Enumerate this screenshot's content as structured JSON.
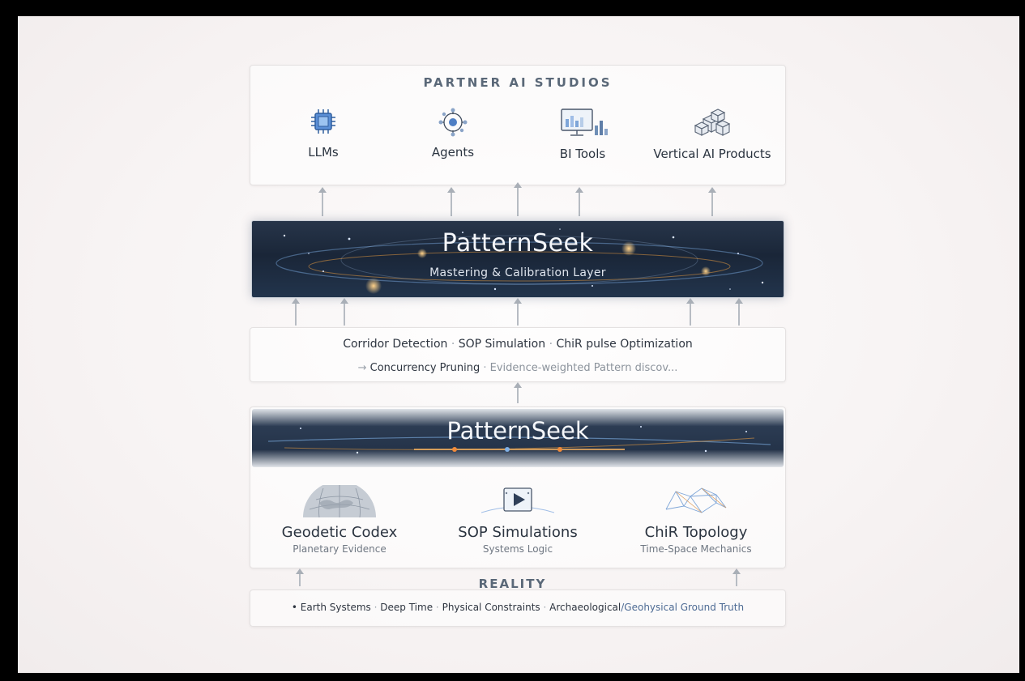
{
  "partner": {
    "title": "PARTNER AI STUDIOS",
    "items": [
      {
        "label": "LLMs",
        "icon": "chip-icon"
      },
      {
        "label": "Agents",
        "icon": "agent-network-icon"
      },
      {
        "label": "BI Tools",
        "icon": "dashboard-monitor-icon"
      },
      {
        "label": "Vertical AI Products",
        "icon": "cubes-icon"
      }
    ]
  },
  "mastering": {
    "title": "PatternSeek",
    "subtitle": "Mastering & Calibration Layer"
  },
  "methods": {
    "line1": [
      "Corridor Detection",
      "SOP Simulation",
      "ChiR pulse Optimization"
    ],
    "line2": [
      "Concurrency Pruning",
      "Evidence-weighted Pattern discov..."
    ],
    "sep": "·",
    "arrow": "→"
  },
  "foundation": {
    "title": "PatternSeek",
    "pillars": [
      {
        "title": "Geodetic Codex",
        "subtitle": "Planetary Evidence",
        "icon": "globe-icon"
      },
      {
        "title": "SOP Simulations",
        "subtitle": "Systems Logic",
        "icon": "play-screen-icon"
      },
      {
        "title": "ChiR Topology",
        "subtitle": "Time-Space Mechanics",
        "icon": "topology-mesh-icon"
      }
    ]
  },
  "reality": {
    "title": "REALITY",
    "bullet": "•",
    "items": [
      "Earth Systems",
      "Deep Time",
      "Physical Constraints"
    ],
    "last_a": "Archaeological",
    "last_sep": "/",
    "last_b": "Geohysical Ground Truth"
  },
  "colors": {
    "band_dark": "#1a2638",
    "accent_orange": "#f0a040",
    "accent_blue": "#7fb0e6",
    "text_dark": "#2b3440",
    "heading_gray": "#5a6878"
  }
}
